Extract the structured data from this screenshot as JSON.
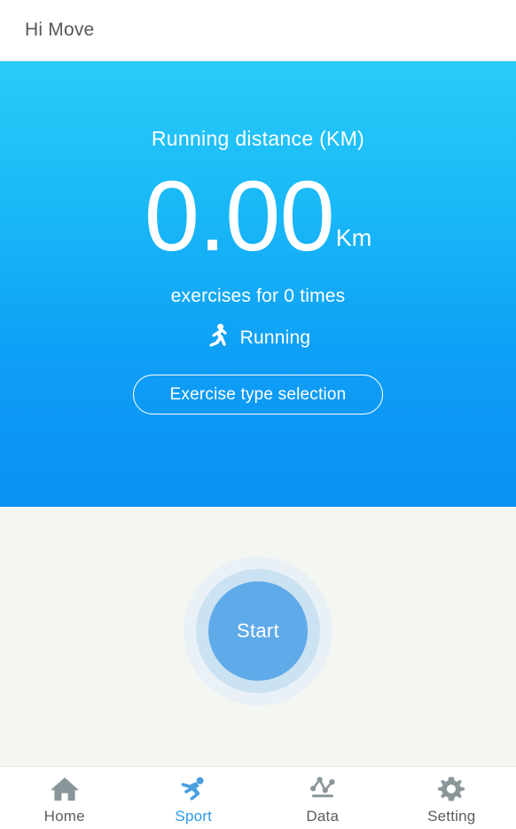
{
  "appbar": {
    "title": "Hi Move"
  },
  "hero": {
    "title": "Running distance (KM)",
    "distance_value": "0.00",
    "distance_unit": "Km",
    "exercise_count_text": "exercises for 0 times",
    "sport_icon": "running-icon",
    "sport_name": "Running",
    "type_button_label": "Exercise type selection",
    "gradient_top": "#29CCF8",
    "gradient_bottom": "#0B8FF4"
  },
  "start": {
    "label": "Start",
    "core_color": "#5FAAE8",
    "ring_inner_color": "#CBE2F2",
    "ring_outer_color": "#E9F1F7"
  },
  "tabbar": {
    "active_color": "#2E9BE8",
    "inactive_color": "#5D5D5D",
    "items": [
      {
        "label": "Home",
        "icon": "home-icon",
        "active": false
      },
      {
        "label": "Sport",
        "icon": "sport-icon",
        "active": true
      },
      {
        "label": "Data",
        "icon": "data-icon",
        "active": false
      },
      {
        "label": "Setting",
        "icon": "gear-icon",
        "active": false
      }
    ]
  }
}
